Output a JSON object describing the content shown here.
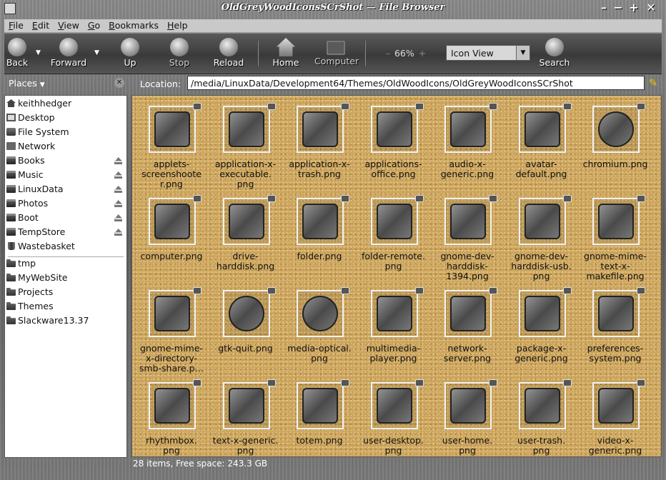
{
  "window": {
    "title": "OldGreyWoodIconsSCrShot — File Browser"
  },
  "menu": [
    {
      "label": "File",
      "key": "F",
      "rest": "ile"
    },
    {
      "label": "Edit",
      "key": "E",
      "rest": "dit"
    },
    {
      "label": "View",
      "key": "V",
      "rest": "iew"
    },
    {
      "label": "Go",
      "key": "G",
      "rest": "o"
    },
    {
      "label": "Bookmarks",
      "key": "B",
      "rest": "ookmarks"
    },
    {
      "label": "Help",
      "key": "H",
      "rest": "elp"
    }
  ],
  "toolbar": {
    "back": "Back",
    "forward": "Forward",
    "up": "Up",
    "stop": "Stop",
    "reload": "Reload",
    "home": "Home",
    "computer": "Computer",
    "zoom": "66%",
    "view_mode": "Icon View",
    "search": "Search"
  },
  "places_label": "Places",
  "location_label": "Location:",
  "location": "/media/LinuxData/Development64/Themes/OldWoodIcons/OldGreyWoodIconsSCrShot",
  "places": [
    {
      "label": "keithhedger",
      "icon": "home-icon",
      "eject": false
    },
    {
      "label": "Desktop",
      "icon": "desktop-icon",
      "eject": false
    },
    {
      "label": "File System",
      "icon": "filesystem-icon",
      "eject": false
    },
    {
      "label": "Network",
      "icon": "network-icon",
      "eject": false
    },
    {
      "label": "Books",
      "icon": "drive-icon",
      "eject": true
    },
    {
      "label": "Music",
      "icon": "drive-icon",
      "eject": true
    },
    {
      "label": "LinuxData",
      "icon": "drive-icon",
      "eject": true
    },
    {
      "label": "Photos",
      "icon": "drive-icon",
      "eject": true
    },
    {
      "label": "Boot",
      "icon": "drive-icon",
      "eject": true
    },
    {
      "label": "TempStore",
      "icon": "drive-icon",
      "eject": true
    },
    {
      "label": "Wastebasket",
      "icon": "trash-icon",
      "eject": false
    }
  ],
  "bookmarks": [
    {
      "label": "tmp"
    },
    {
      "label": "MyWebSite"
    },
    {
      "label": "Projects"
    },
    {
      "label": "Themes"
    },
    {
      "label": "Slackware13.37"
    }
  ],
  "files": [
    "applets-screenshooter.png",
    "application-x-executable.png",
    "application-x-trash.png",
    "applications-office.png",
    "audio-x-generic.png",
    "avatar-default.png",
    "chromium.png",
    "computer.png",
    "drive-harddisk.png",
    "folder.png",
    "folder-remote.png",
    "gnome-dev-harddisk-1394.png",
    "gnome-dev-harddisk-usb.png",
    "gnome-mime-text-x-makefile.png",
    "gnome-mime-x-directory-smb-share.p…",
    "gtk-quit.png",
    "media-optical.png",
    "multimedia-player.png",
    "network-server.png",
    "package-x-generic.png",
    "preferences-system.png",
    "rhythmbox.png",
    "text-x-generic.png",
    "totem.png",
    "user-desktop.png",
    "user-home.png",
    "user-trash.png",
    "video-x-generic.png"
  ],
  "file_labels": [
    [
      "applets-",
      "screenshoote",
      "r.png"
    ],
    [
      "application-x-",
      "executable.",
      "png"
    ],
    [
      "application-x-",
      "trash.png"
    ],
    [
      "applications-",
      "office.png"
    ],
    [
      "audio-x-",
      "generic.png"
    ],
    [
      "avatar-",
      "default.png"
    ],
    [
      "chromium.png"
    ],
    [
      "computer.png"
    ],
    [
      "drive-",
      "harddisk.png"
    ],
    [
      "folder.png"
    ],
    [
      "folder-remote.",
      "png"
    ],
    [
      "gnome-dev-",
      "harddisk-",
      "1394.png"
    ],
    [
      "gnome-dev-",
      "harddisk-usb.",
      "png"
    ],
    [
      "gnome-mime-",
      "text-x-",
      "makefile.png"
    ],
    [
      "gnome-mime-",
      "x-directory-",
      "smb-share.p…"
    ],
    [
      "gtk-quit.png"
    ],
    [
      "media-optical.",
      "png"
    ],
    [
      "multimedia-",
      "player.png"
    ],
    [
      "network-",
      "server.png"
    ],
    [
      "package-x-",
      "generic.png"
    ],
    [
      "preferences-",
      "system.png"
    ],
    [
      "rhythmbox.",
      "png"
    ],
    [
      "text-x-generic.",
      "png"
    ],
    [
      "totem.png"
    ],
    [
      "user-desktop.",
      "png"
    ],
    [
      "user-home.",
      "png"
    ],
    [
      "user-trash.",
      "png"
    ],
    [
      "video-x-",
      "generic.png"
    ]
  ],
  "status": "28 items, Free space: 243.3 GB"
}
